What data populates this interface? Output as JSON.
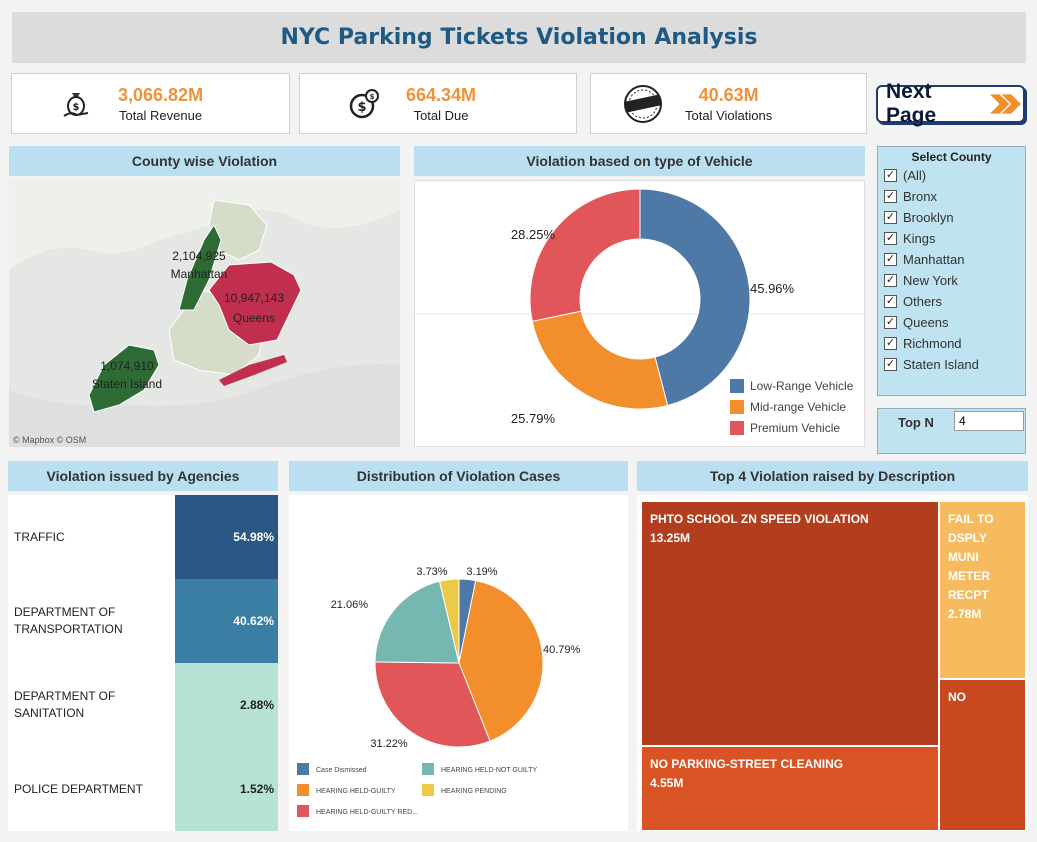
{
  "header": {
    "title": "NYC Parking Tickets Violation Analysis"
  },
  "kpis": [
    {
      "value": "3,066.82M",
      "label": "Total Revenue",
      "icon": "money-bag-icon"
    },
    {
      "value": "664.34M",
      "label": "Total Due",
      "icon": "dollar-coins-icon"
    },
    {
      "value": "40.63M",
      "label": "Total Violations",
      "icon": "violation-stamp-icon"
    }
  ],
  "nav": {
    "next_label": "Next Page"
  },
  "map": {
    "title": "County wise Violation",
    "labels": [
      {
        "value": "2,104,925",
        "name": "Manhattan"
      },
      {
        "value": "10,947,143",
        "name": "Queens"
      },
      {
        "value": "1,074,910",
        "name": "Staten Island"
      }
    ],
    "attribution": "© Mapbox  © OSM",
    "colors": {
      "high": "#c0304e",
      "mid": "#2e6b34",
      "low": "#d5dcc7"
    }
  },
  "filter": {
    "title": "Select County",
    "options": [
      "(All)",
      "Bronx",
      "Brooklyn",
      "Kings",
      "Manhattan",
      "New York",
      "Others",
      "Queens",
      "Richmond",
      "Staten Island"
    ],
    "checked": true
  },
  "topn": {
    "label": "Top N",
    "value": "4"
  },
  "chart_data": [
    {
      "type": "pie",
      "variant": "donut",
      "title": "Violation based on type of Vehicle",
      "categories": [
        "Low-Range Vehicle",
        "Mid-range Vehicle",
        "Premium Vehicle"
      ],
      "values": [
        45.96,
        25.79,
        28.25
      ],
      "value_labels": [
        "45.96%",
        "25.79%",
        "28.25%"
      ],
      "colors": [
        "#4e79a7",
        "#f28e2b",
        "#e15759"
      ],
      "legend": "bottom-right"
    },
    {
      "type": "bar",
      "title": "Violation issued by Agencies",
      "categories": [
        "TRAFFIC",
        "DEPARTMENT OF TRANSPORTATION",
        "DEPARTMENT OF SANITATION",
        "POLICE DEPARTMENT"
      ],
      "values": [
        54.98,
        40.62,
        2.88,
        1.52
      ],
      "value_labels": [
        "54.98%",
        "40.62%",
        "2.88%",
        "1.52%"
      ],
      "colors": [
        "#2a5783",
        "#3a7ea3",
        "#b7e3d7",
        "#b7e3d7"
      ]
    },
    {
      "type": "pie",
      "title": "Distribution of Violation Cases",
      "categories": [
        "Case Dismissed",
        "HEARING HELD-GUILTY",
        "HEARING HELD-GUILTY RED...",
        "HEARING HELD-NOT GUILTY",
        "HEARING PENDING"
      ],
      "values": [
        3.19,
        40.79,
        31.22,
        21.06,
        3.73
      ],
      "value_labels": [
        "3.19%",
        "40.79%",
        "31.22%",
        "21.06%",
        "3.73%"
      ],
      "colors": [
        "#4e79a7",
        "#f28e2b",
        "#e15759",
        "#76b7b2",
        "#edc948"
      ],
      "legend": "bottom"
    },
    {
      "type": "treemap",
      "title": "Top 4 Violation raised by Description",
      "items": [
        {
          "label": "PHTO SCHOOL ZN SPEED VIOLATION",
          "value": 13.25,
          "value_label": "13.25M",
          "color": "#b23e1e"
        },
        {
          "label": "NO PARKING-STREET CLEANING",
          "value": 4.55,
          "value_label": "4.55M",
          "color": "#d95324"
        },
        {
          "label": "FAIL TO DSPLY MUNI METER RECPT",
          "value": 2.78,
          "value_label": "2.78M",
          "color": "#f5bb5e"
        },
        {
          "label": "NO",
          "value": null,
          "value_label": "",
          "color": "#c8481f"
        }
      ]
    }
  ]
}
